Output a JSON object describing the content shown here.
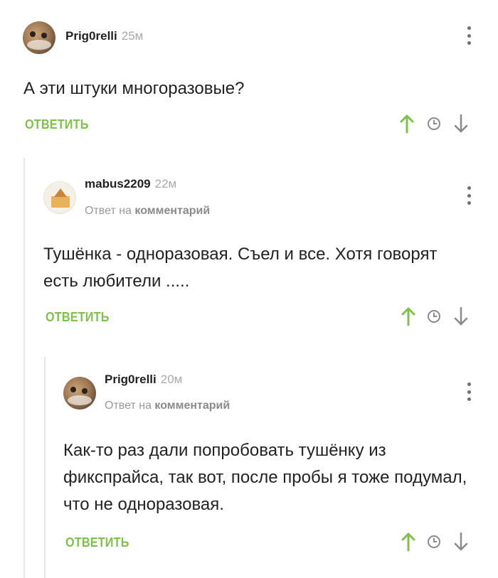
{
  "comments": [
    {
      "username": "Prig0relli",
      "time": "25м",
      "text": "А эти штуки многоразовые?",
      "reply_label": "ОТВЕТИТЬ"
    },
    {
      "username": "mabus2209",
      "time": "22м",
      "reply_to_prefix": "Ответ на",
      "reply_to_link": "комментарий",
      "text": "Тушёнка - одноразовая. Съел и все. Хотя говорят есть любители .....",
      "reply_label": "ОТВЕТИТЬ"
    },
    {
      "username": "Prig0relli",
      "time": "20м",
      "reply_to_prefix": "Ответ на",
      "reply_to_link": "комментарий",
      "text": "Как-то раз дали попробовать тушёнку из фикспрайса, так вот, после пробы я тоже подумал, что не одноразовая.",
      "reply_label": "ОТВЕТИТЬ"
    }
  ],
  "colors": {
    "accent_green": "#7fc04d",
    "icon_gray": "#8a8a8a",
    "thread_line": "#e6e6e6"
  },
  "icons": {
    "upvote": "arrow-up-icon",
    "clock": "clock-icon",
    "downvote": "arrow-down-icon",
    "more": "more-vertical-icon"
  }
}
